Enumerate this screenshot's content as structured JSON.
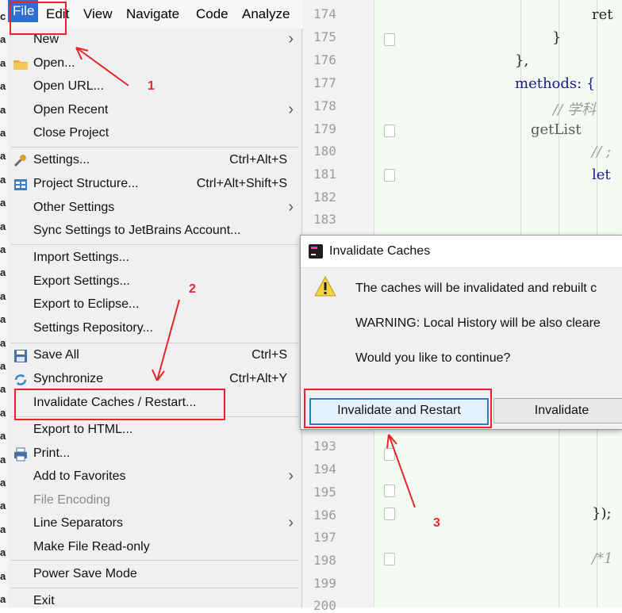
{
  "left_strip": {
    "chars": [
      "c",
      "a",
      "a",
      "a",
      "a",
      "a",
      "a",
      "a",
      "a",
      "a",
      "a",
      "a",
      "a",
      "a",
      "a",
      "a",
      "a",
      "a",
      "a",
      "a",
      "a",
      "a",
      "a",
      "a",
      "a",
      "a"
    ]
  },
  "menubar": {
    "items": [
      {
        "label": "File"
      },
      {
        "label": "Edit"
      },
      {
        "label": "View"
      },
      {
        "label": "Navigate"
      },
      {
        "label": "Code"
      },
      {
        "label": "Analyze"
      }
    ]
  },
  "file_menu": {
    "new": "New",
    "open": "Open...",
    "open_url": "Open URL...",
    "open_recent": "Open Recent",
    "close_project": "Close Project",
    "settings": "Settings...",
    "settings_shortcut": "Ctrl+Alt+S",
    "project_structure": "Project Structure...",
    "project_structure_shortcut": "Ctrl+Alt+Shift+S",
    "other_settings": "Other Settings",
    "sync_settings": "Sync Settings to JetBrains Account...",
    "import_settings": "Import Settings...",
    "export_settings": "Export Settings...",
    "export_eclipse": "Export to Eclipse...",
    "settings_repository": "Settings Repository...",
    "save_all": "Save All",
    "save_all_shortcut": "Ctrl+S",
    "synchronize": "Synchronize",
    "synchronize_shortcut": "Ctrl+Alt+Y",
    "invalidate_caches": "Invalidate Caches / Restart...",
    "export_html": "Export to HTML...",
    "print": "Print...",
    "add_favorites": "Add to Favorites",
    "file_encoding": "File Encoding",
    "line_separators": "Line Separators",
    "make_read_only": "Make File Read-only",
    "power_save": "Power Save Mode",
    "exit": "Exit"
  },
  "editor": {
    "line_numbers": [
      "174",
      "175",
      "176",
      "177",
      "178",
      "179",
      "180",
      "181",
      "182",
      "183",
      "193",
      "194",
      "195",
      "196",
      "197",
      "198",
      "199",
      "200"
    ],
    "code": {
      "l174": "ret",
      "l175": "}",
      "l176": "},",
      "l177": "methods: {",
      "l178": "// 学科",
      "l179": "getList",
      "l180": "// ;",
      "l181": "let",
      "l196": "});",
      "l198": "/*1"
    }
  },
  "dialog": {
    "title": "Invalidate Caches",
    "message1": "The caches will be invalidated and rebuilt c",
    "message2": "WARNING: Local History will be also cleare",
    "message3": "Would you like to continue?",
    "btn_restart": "Invalidate and Restart",
    "btn_invalidate": "Invalidate"
  },
  "annotations": {
    "n1": "1",
    "n2": "2",
    "n3": "3"
  },
  "colors": {
    "accent": "#2e6fd6",
    "annotation": "#e8242a",
    "focus_border": "#2a7bd4"
  }
}
